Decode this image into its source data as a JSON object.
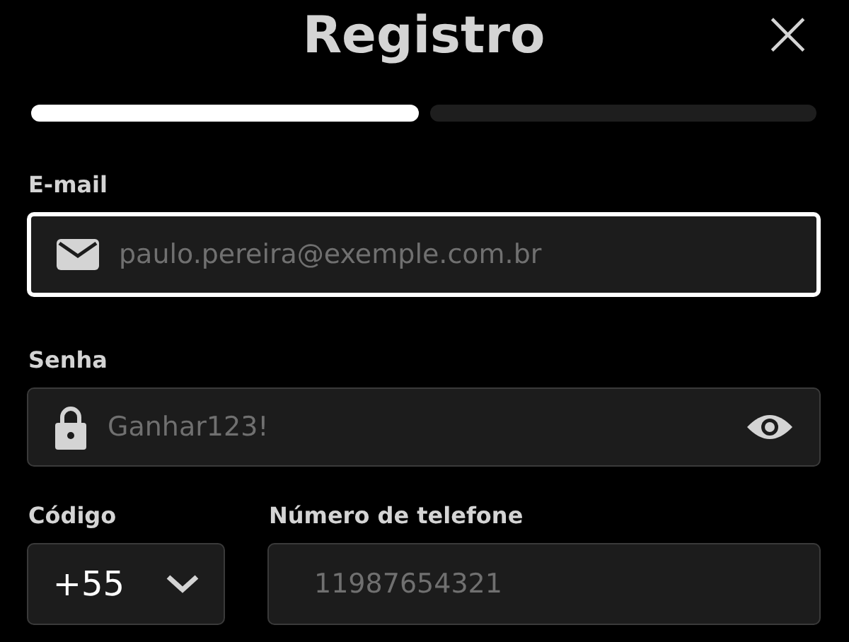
{
  "header": {
    "title": "Registro",
    "close": "×"
  },
  "steps": [
    {
      "done": true
    },
    {
      "done": false
    }
  ],
  "email": {
    "label": "E-mail",
    "placeholder": "paulo.pereira@exemple.com.br",
    "focused": true
  },
  "password": {
    "label": "Senha",
    "placeholder": "Ganhar123!",
    "focused": false
  },
  "code": {
    "label": "Código",
    "value": "+55"
  },
  "phone": {
    "label": "Número de telefone",
    "placeholder": "11987654321",
    "focused": false
  }
}
